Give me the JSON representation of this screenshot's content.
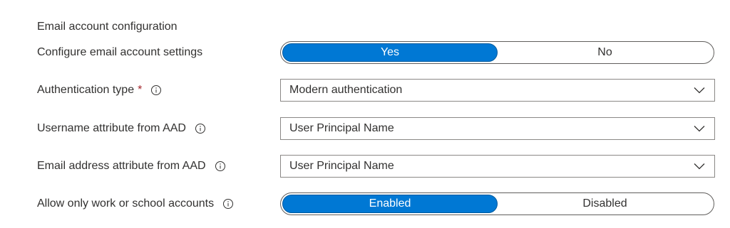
{
  "section": {
    "title": "Email account configuration"
  },
  "configure_email": {
    "label": "Configure email account settings",
    "options": [
      "Yes",
      "No"
    ],
    "selected": "Yes"
  },
  "auth_type": {
    "label": "Authentication type",
    "required_marker": "*",
    "value": "Modern authentication",
    "info_icon": "info-icon",
    "chevron_icon": "chevron-down-icon"
  },
  "username_attr": {
    "label": "Username attribute from AAD",
    "value": "User Principal Name",
    "info_icon": "info-icon",
    "chevron_icon": "chevron-down-icon"
  },
  "email_attr": {
    "label": "Email address attribute from AAD",
    "value": "User Principal Name",
    "info_icon": "info-icon",
    "chevron_icon": "chevron-down-icon"
  },
  "work_school": {
    "label": "Allow only work or school accounts",
    "options": [
      "Enabled",
      "Disabled"
    ],
    "selected": "Enabled",
    "info_icon": "info-icon"
  },
  "colors": {
    "accent": "#0078d4",
    "text": "#323130",
    "required": "#a4262c",
    "border": "#8a8886"
  }
}
